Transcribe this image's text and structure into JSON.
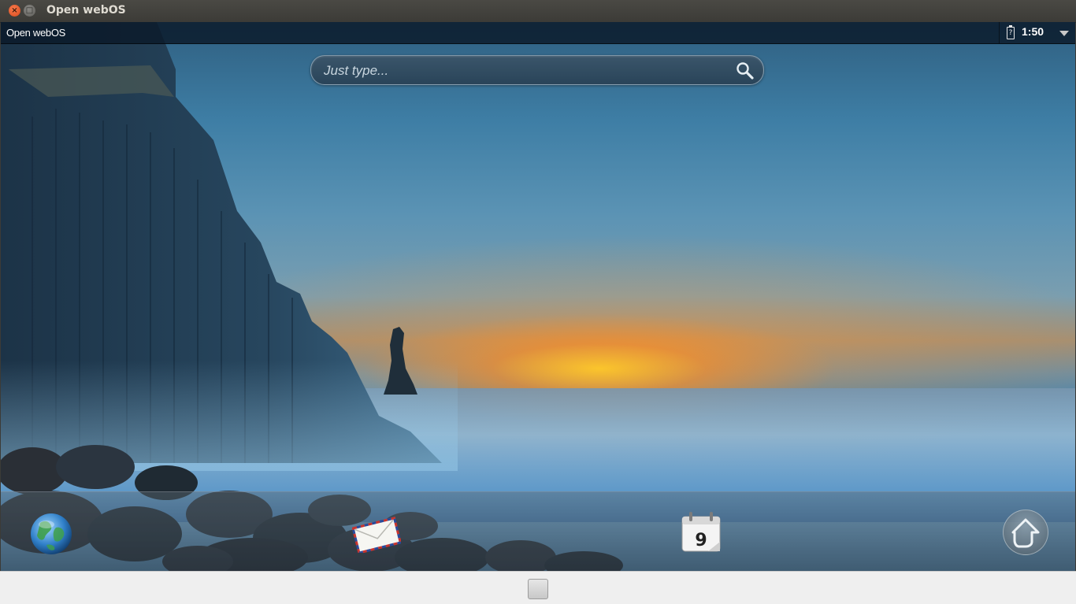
{
  "window": {
    "title": "Open webOS",
    "close_glyph": "×",
    "maximize_glyph": "□"
  },
  "statusbar": {
    "brand": "Open webOS",
    "time": "1:50",
    "battery_icon": "battery-unknown-icon",
    "menu_icon": "chevron-down-icon"
  },
  "search": {
    "placeholder": "Just type...",
    "value": "",
    "icon": "search-icon"
  },
  "dock": {
    "apps": [
      {
        "name": "Browser",
        "icon": "globe-icon"
      },
      {
        "name": "Email",
        "icon": "envelope-icon"
      },
      {
        "name": "Calendar",
        "icon": "calendar-icon",
        "day": "9"
      }
    ],
    "launcher_icon": "up-arrow-icon"
  },
  "colors": {
    "titlebar": "#3c3b37",
    "statusbar": "#0a1928",
    "sunset": "#ffc828",
    "sea": "#5a93bf"
  }
}
